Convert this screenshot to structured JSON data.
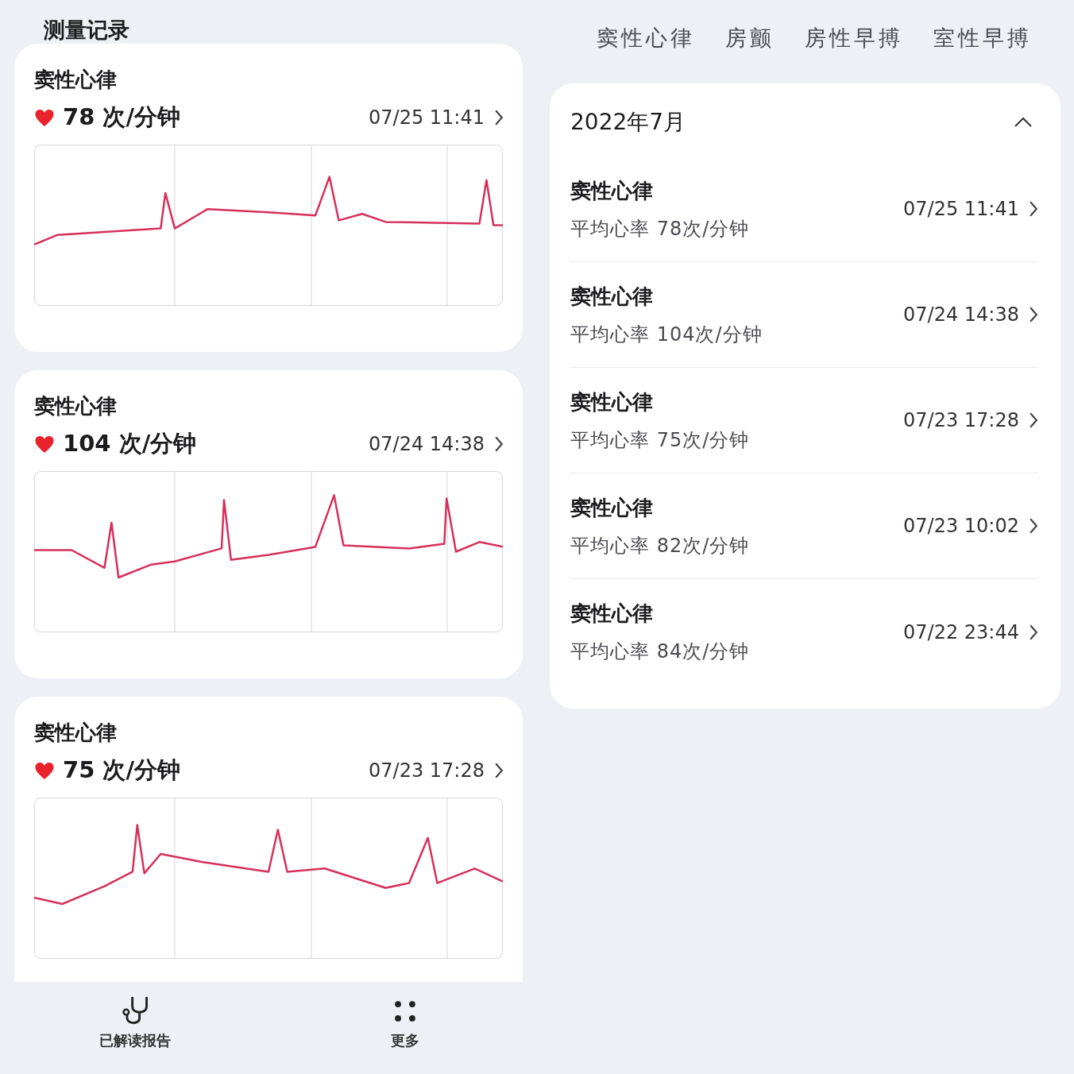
{
  "page_title": "测量记录",
  "tabs": [
    {
      "label": "窦性心律"
    },
    {
      "label": "房颤"
    },
    {
      "label": "房性早搏"
    },
    {
      "label": "室性早搏"
    }
  ],
  "cards": [
    {
      "title": "窦性心律",
      "heart_rate": "78 次/分钟",
      "time": "07/25 11:41"
    },
    {
      "title": "窦性心律",
      "heart_rate": "104 次/分钟",
      "time": "07/24 14:38"
    },
    {
      "title": "窦性心律",
      "heart_rate": "75 次/分钟",
      "time": "07/23 17:28"
    }
  ],
  "month_panel": {
    "title": "2022年7月",
    "expanded": true,
    "records": [
      {
        "title": "窦性心律",
        "summary": "平均心率 78次/分钟",
        "time": "07/25 11:41"
      },
      {
        "title": "窦性心律",
        "summary": "平均心率 104次/分钟",
        "time": "07/24 14:38"
      },
      {
        "title": "窦性心律",
        "summary": "平均心率 75次/分钟",
        "time": "07/23 17:28"
      },
      {
        "title": "窦性心律",
        "summary": "平均心率 82次/分钟",
        "time": "07/23 10:02"
      },
      {
        "title": "窦性心律",
        "summary": "平均心率 84次/分钟",
        "time": "07/22 23:44"
      }
    ]
  },
  "bottom_nav": [
    {
      "label": "已解读报告",
      "kind": "stethoscope"
    },
    {
      "label": "更多",
      "kind": "dots"
    }
  ]
}
